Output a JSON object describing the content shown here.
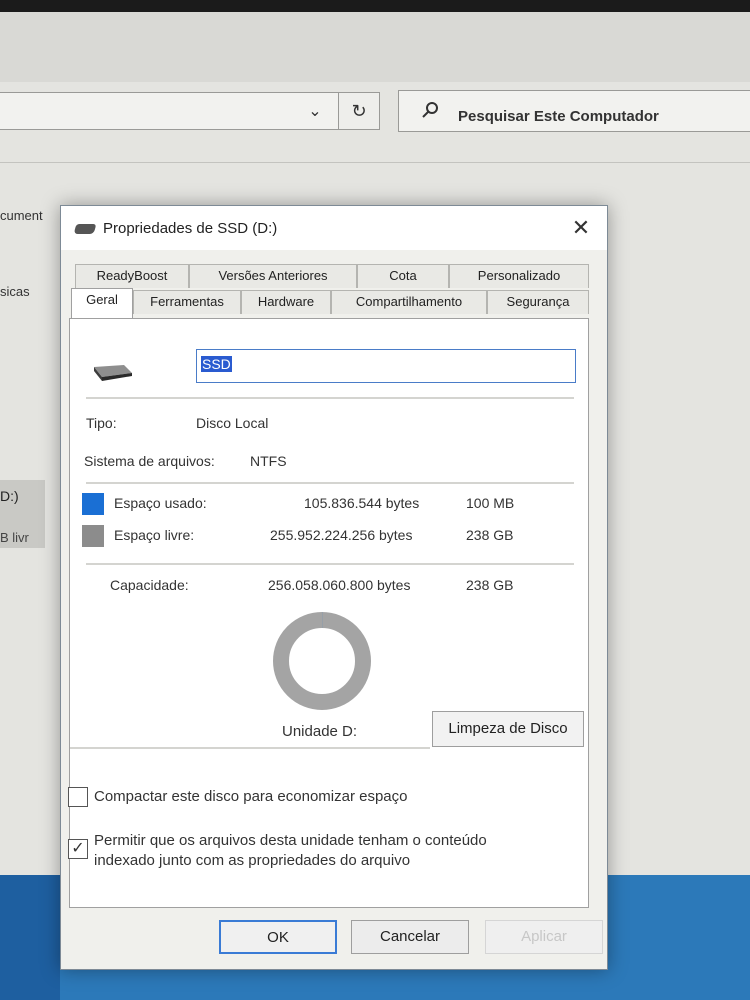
{
  "explorer": {
    "search_placeholder": "Pesquisar Este Computador",
    "left_items": [
      "cument",
      "sicas"
    ],
    "drive_label": "D:)",
    "drive_free": "B livr"
  },
  "dialog": {
    "title": "Propriedades de SSD (D:)",
    "close_label": "✕",
    "tabs_row1": [
      "ReadyBoost",
      "Versões Anteriores",
      "Cota",
      "Personalizado"
    ],
    "tabs_row2": [
      "Geral",
      "Ferramentas",
      "Hardware",
      "Compartilhamento",
      "Segurança"
    ],
    "active_tab": "Geral",
    "drive_name": "SSD",
    "type_label": "Tipo:",
    "type_value": "Disco Local",
    "fs_label": "Sistema de arquivos:",
    "fs_value": "NTFS",
    "used": {
      "label": "Espaço usado:",
      "bytes": "105.836.544 bytes",
      "size": "100 MB",
      "color": "#1a6fd4"
    },
    "free": {
      "label": "Espaço livre:",
      "bytes": "255.952.224.256 bytes",
      "size": "238 GB",
      "color": "#8c8c8c"
    },
    "capacity": {
      "label": "Capacidade:",
      "bytes": "256.058.060.800 bytes",
      "size": "238 GB"
    },
    "used_fraction": 0.0004,
    "drive_caption": "Unidade D:",
    "cleanup_label": "Limpeza de Disco",
    "compress_label": "Compactar este disco para economizar espaço",
    "compress_checked": false,
    "index_label_line1": "Permitir que os arquivos desta unidade tenham o conteúdo",
    "index_label_line2": "indexado junto com as propriedades do arquivo",
    "index_checked": true,
    "ok_label": "OK",
    "cancel_label": "Cancelar",
    "apply_label": "Aplicar"
  }
}
